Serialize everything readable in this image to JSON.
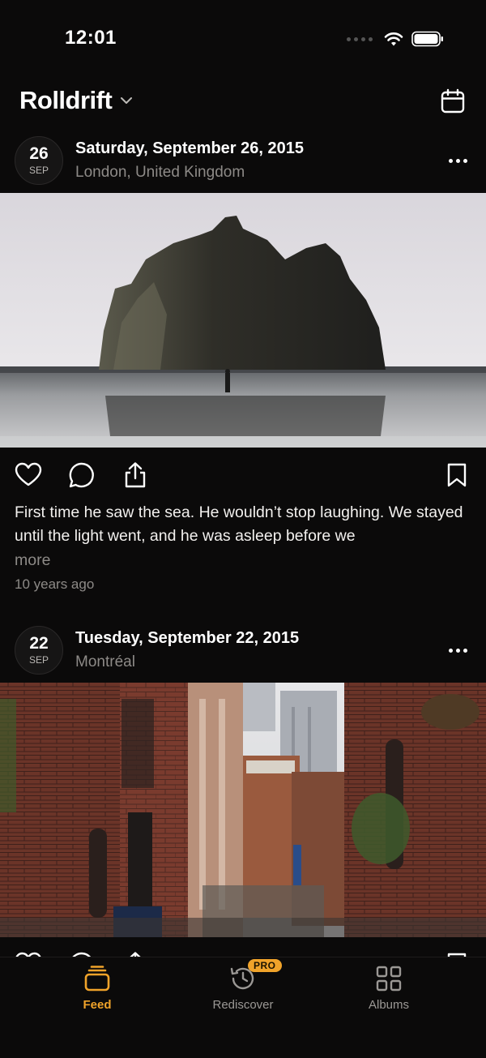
{
  "status_bar": {
    "time": "12:01"
  },
  "header": {
    "title": "Rolldrift",
    "title_icon": "chevron-down-icon",
    "calendar_icon": "calendar-icon"
  },
  "posts": [
    {
      "day": "26",
      "month": "SEP",
      "date": "Saturday, September 26, 2015",
      "location": "London, United Kingdom",
      "caption": "First time he saw the sea. He wouldn’t stop laughing. We stayed until the light went, and he was asleep before we",
      "more": "more",
      "time_ago": "10 years ago"
    },
    {
      "day": "22",
      "month": "SEP",
      "date": "Tuesday, September 22, 2015",
      "location": "Montréal"
    }
  ],
  "tabs": [
    {
      "label": "Feed",
      "icon": "feed-stack-icon",
      "active": true
    },
    {
      "label": "Rediscover",
      "icon": "history-clock-icon",
      "badge": "PRO"
    },
    {
      "label": "Albums",
      "icon": "grid-icon"
    }
  ],
  "colors": {
    "background": "#0b0a0a",
    "accent": "#f0a32a",
    "muted_text": "#8d8a87"
  }
}
